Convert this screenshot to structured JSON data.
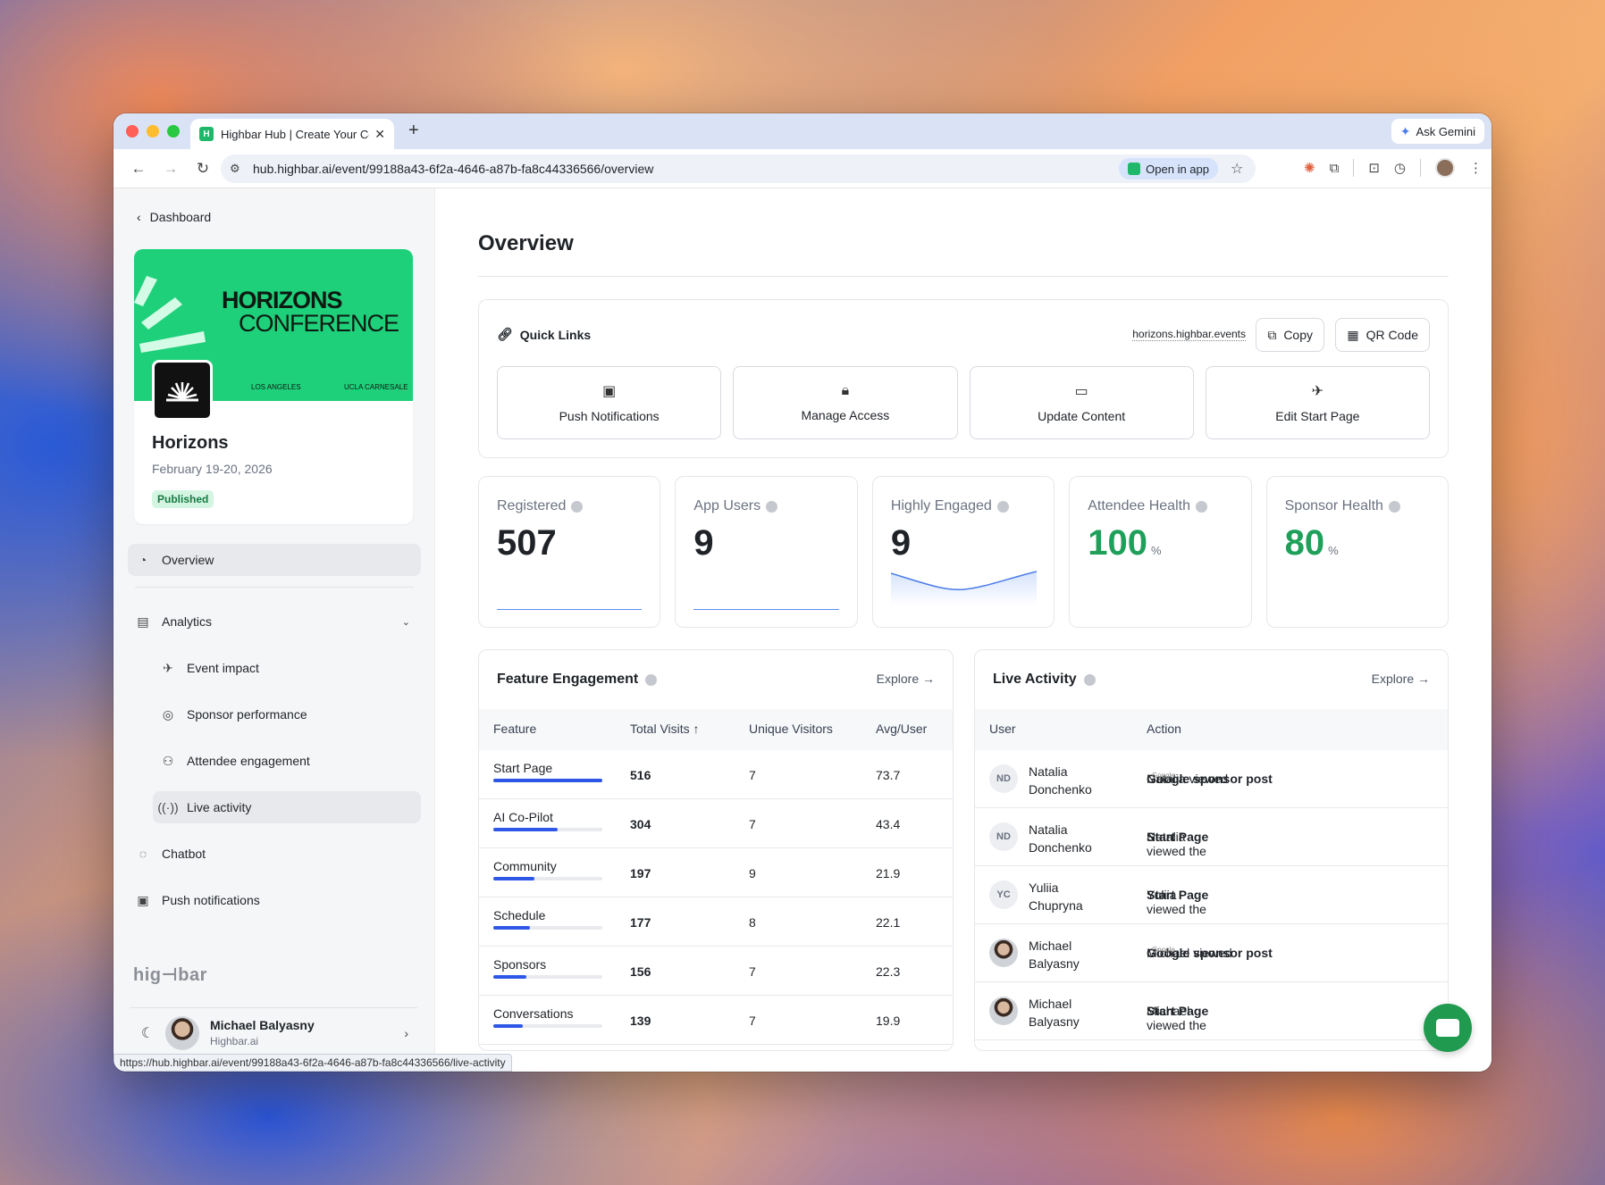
{
  "browser": {
    "tab_title": "Highbar Hub | Create Your Co",
    "url": "hub.highbar.ai/event/99188a43-6f2a-4646-a87b-fa8c44336566/overview",
    "open_in_app": "Open in app",
    "ask_gemini": "Ask Gemini",
    "status_url": "https://hub.highbar.ai/event/99188a43-6f2a-4646-a87b-fa8c44336566/live-activity"
  },
  "sidebar": {
    "back_label": "Dashboard",
    "banner": {
      "line1": "HORIZONS",
      "line2": "CONFERENCE",
      "loc1": "LOS ANGELES",
      "loc2": "UCLA CARNESALE"
    },
    "event": {
      "name": "Horizons",
      "date": "February 19-20, 2026",
      "status": "Published"
    },
    "nav": {
      "overview": "Overview",
      "analytics": "Analytics",
      "event_impact": "Event impact",
      "sponsor_performance": "Sponsor performance",
      "attendee_engagement": "Attendee engagement",
      "live_activity": "Live activity",
      "chatbot": "Chatbot",
      "push_notifications": "Push notifications"
    },
    "brand": "hig⊣bar",
    "user": {
      "name": "Michael Balyasny",
      "company": "Highbar.ai"
    }
  },
  "main": {
    "title": "Overview",
    "quick_links": {
      "title": "Quick Links",
      "url": "horizons.highbar.events",
      "copy": "Copy",
      "qr": "QR Code",
      "cards": [
        "Push Notifications",
        "Manage Access",
        "Update Content",
        "Edit Start Page"
      ]
    },
    "stats": [
      {
        "label": "Registered",
        "value": "507",
        "unit": ""
      },
      {
        "label": "App Users",
        "value": "9",
        "unit": ""
      },
      {
        "label": "Highly Engaged",
        "value": "9",
        "unit": ""
      },
      {
        "label": "Attendee Health",
        "value": "100",
        "unit": "%"
      },
      {
        "label": "Sponsor Health",
        "value": "80",
        "unit": "%"
      }
    ],
    "feature_engagement": {
      "title": "Feature Engagement",
      "explore": "Explore →",
      "headers": [
        "Feature",
        "Total Visits ↑",
        "Unique Visitors",
        "Avg/User"
      ],
      "rows": [
        {
          "feature": "Start Page",
          "visits": "516",
          "unique": "7",
          "avg": "73.7",
          "share": 1.0
        },
        {
          "feature": "AI Co-Pilot",
          "visits": "304",
          "unique": "7",
          "avg": "43.4",
          "share": 0.59
        },
        {
          "feature": "Community",
          "visits": "197",
          "unique": "9",
          "avg": "21.9",
          "share": 0.38
        },
        {
          "feature": "Schedule",
          "visits": "177",
          "unique": "8",
          "avg": "22.1",
          "share": 0.34
        },
        {
          "feature": "Sponsors",
          "visits": "156",
          "unique": "7",
          "avg": "22.3",
          "share": 0.3
        },
        {
          "feature": "Conversations",
          "visits": "139",
          "unique": "7",
          "avg": "19.9",
          "share": 0.27
        }
      ]
    },
    "live_activity": {
      "title": "Live Activity",
      "explore": "Explore →",
      "headers": [
        "User",
        "Action"
      ],
      "rows": [
        {
          "initials": "ND",
          "first": "Natalia",
          "last": "Donchenko",
          "prefix": "Natalia viewed",
          "target": "Google sponsor post",
          "logo": "Google"
        },
        {
          "initials": "ND",
          "first": "Natalia",
          "last": "Donchenko",
          "prefix": "Natalia viewed the",
          "target": "Start Page",
          "logo": ""
        },
        {
          "initials": "YC",
          "first": "Yuliia",
          "last": "Chupryna",
          "prefix": "Yuliia viewed the",
          "target": "Start Page",
          "logo": ""
        },
        {
          "initials": "",
          "first": "Michael",
          "last": "Balyasny",
          "prefix": "Michael viewed",
          "target": "Google sponsor post",
          "logo": "Google"
        },
        {
          "initials": "",
          "first": "Michael",
          "last": "Balyasny",
          "prefix": "Michael viewed the",
          "target": "Start Page",
          "logo": ""
        }
      ]
    }
  }
}
